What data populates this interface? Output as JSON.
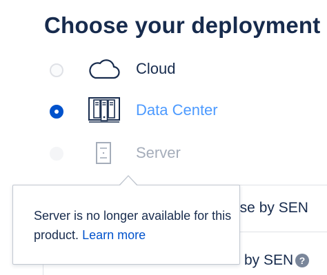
{
  "page": {
    "title": "Choose your deployment"
  },
  "options": [
    {
      "label": "Cloud",
      "icon": "cloud-icon",
      "state": "unselected"
    },
    {
      "label": "Data Center",
      "icon": "data-center-icon",
      "state": "selected"
    },
    {
      "label": "Server",
      "icon": "server-icon",
      "state": "disabled"
    }
  ],
  "tooltip": {
    "message": "Server is no longer available for this product.",
    "link_label": "Learn more"
  },
  "background_table": {
    "row1_text": "nse by SEN",
    "row2_text": "by SEN",
    "help_icon_glyph": "?"
  },
  "colors": {
    "primary_text": "#172b4d",
    "selected_label": "#4c9aff",
    "selected_radio": "#0052cc",
    "disabled_text": "#a5adba",
    "link": "#0052cc"
  }
}
